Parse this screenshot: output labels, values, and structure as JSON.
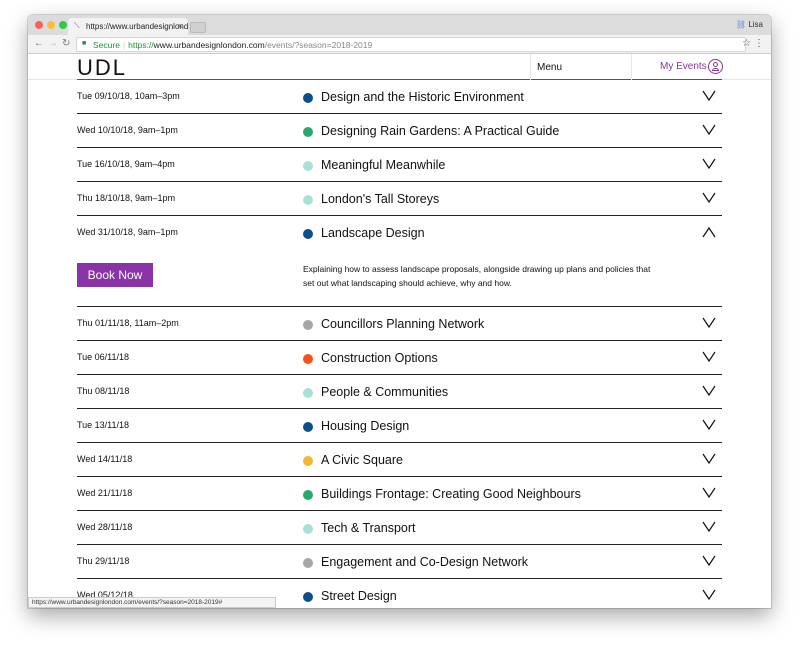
{
  "browser": {
    "tab_title": "https://www.urbandesignlondo",
    "profile_name": "Lisa",
    "secure_label": "Secure",
    "url_scheme": "https://",
    "url_host": "www.urbandesignlondon.com",
    "url_path": "/events/?season=2018-2019",
    "status_url": "https://www.urbandesignlondon.com/events/?season=2018-2019#"
  },
  "header": {
    "logo": "UDL",
    "menu_label": "Menu",
    "my_events_label": "My Events",
    "accent": "#8a33a8"
  },
  "events": [
    {
      "date": "Tue 09/10/18, 10am–3pm",
      "title": "Design and the Historic Environment",
      "color": "#0b4f8a"
    },
    {
      "date": "Wed 10/10/18, 9am–1pm",
      "title": "Designing Rain Gardens: A Practical Guide",
      "color": "#2aa86b"
    },
    {
      "date": "Tue 16/10/18, 9am–4pm",
      "title": "Meaningful Meanwhile",
      "color": "#a8e0d8"
    },
    {
      "date": "Thu 18/10/18, 9am–1pm",
      "title": "London's Tall Storeys",
      "color": "#a8e0d8"
    },
    {
      "date": "Wed 31/10/18, 9am–1pm",
      "title": "Landscape Design",
      "color": "#0b4f8a",
      "expanded": true,
      "book_label": "Book Now",
      "description": "Explaining how to assess landscape proposals, alongside drawing up plans and policies that set out what landscaping should achieve, why and how."
    },
    {
      "date": "Thu 01/11/18, 11am–2pm",
      "title": "Councillors Planning Network",
      "color": "#a6a6a6"
    },
    {
      "date": "Tue 06/11/18",
      "title": "Construction Options",
      "color": "#f4511e"
    },
    {
      "date": "Thu 08/11/18",
      "title": "People & Communities",
      "color": "#a8e0d8"
    },
    {
      "date": "Tue 13/11/18",
      "title": "Housing Design",
      "color": "#0b4f8a"
    },
    {
      "date": "Wed 14/11/18",
      "title": "A Civic Square",
      "color": "#f5b731"
    },
    {
      "date": "Wed 21/11/18",
      "title": "Buildings Frontage: Creating Good Neighbours",
      "color": "#2aa86b"
    },
    {
      "date": "Wed 28/11/18",
      "title": "Tech & Transport",
      "color": "#a8e0d8"
    },
    {
      "date": "Thu 29/11/18",
      "title": "Engagement and Co-Design Network",
      "color": "#a6a6a6"
    },
    {
      "date": "Wed 05/12/18",
      "title": "Street Design",
      "color": "#0b4f8a"
    }
  ]
}
